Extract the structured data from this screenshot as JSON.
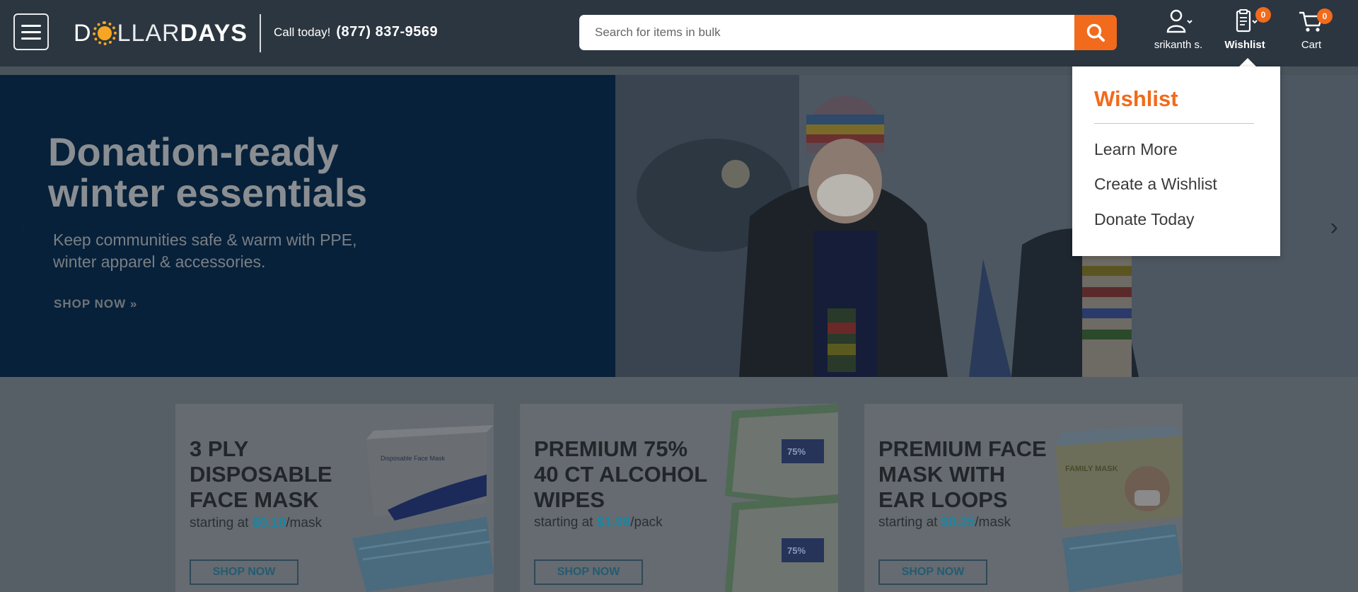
{
  "header": {
    "menu_icon": "hamburger-menu-icon",
    "logo": {
      "part1": "D",
      "part2": "LLAR",
      "part3": "DAYS",
      "icon": "sun-icon"
    },
    "call_label": "Call today!",
    "call_number": "(877) 837-9569",
    "search": {
      "placeholder": "Search for items in bulk",
      "value": "",
      "icon": "search-icon"
    },
    "account": {
      "label": "srikanth s.",
      "icon": "user-icon"
    },
    "wishlist": {
      "label": "Wishlist",
      "count": "0",
      "icon": "clipboard-icon"
    },
    "cart": {
      "label": "Cart",
      "count": "0",
      "icon": "cart-icon"
    }
  },
  "hero": {
    "title_line1": "Donation-ready",
    "title_line2": "winter essentials",
    "subtitle_line1": "Keep communities safe & warm with PPE,",
    "subtitle_line2": "winter apparel & accessories.",
    "cta": "SHOP NOW »",
    "prev_icon": "chevron-left-icon",
    "next_icon": "chevron-right-icon"
  },
  "promos": [
    {
      "title": [
        "3 PLY",
        "DISPOSABLE",
        "FACE MASK"
      ],
      "price_prefix": "starting at",
      "price": "$0.10",
      "unit": "/mask",
      "button": "SHOP NOW"
    },
    {
      "title": [
        "PREMIUM 75%",
        "40 CT ALCOHOL",
        "WIPES"
      ],
      "price_prefix": "starting at",
      "price": "$1.99",
      "unit": "/pack",
      "button": "SHOP NOW"
    },
    {
      "title": [
        "PREMIUM FACE",
        "MASK WITH",
        "EAR LOOPS"
      ],
      "price_prefix": "starting at",
      "price": "$0.25",
      "unit": "/mask",
      "button": "SHOP NOW"
    }
  ],
  "wishlist_dropdown": {
    "title": "Wishlist",
    "items": [
      "Learn More",
      "Create a Wishlist",
      "Donate Today"
    ]
  },
  "colors": {
    "brand_orange": "#f26a1b",
    "header_bg": "#2c3640",
    "hero_bg": "#07213a",
    "price_blue": "#1a86a4"
  }
}
